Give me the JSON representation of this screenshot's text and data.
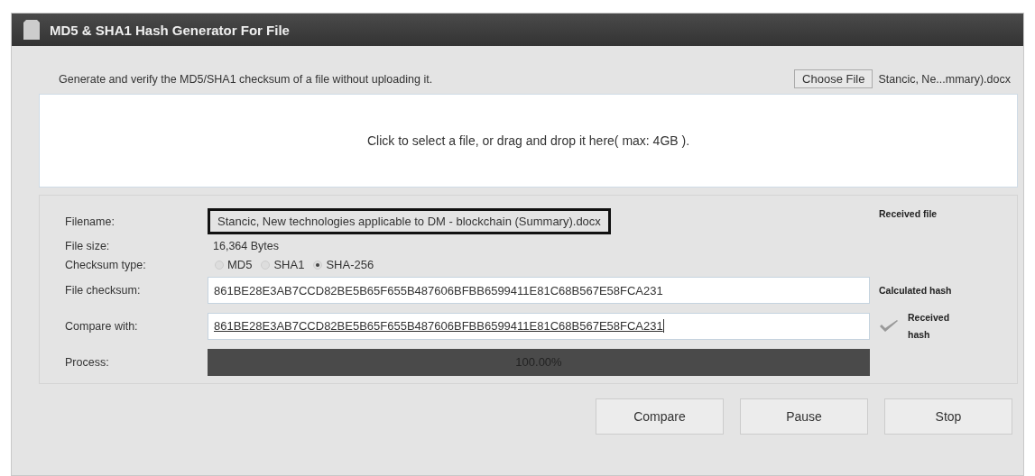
{
  "window": {
    "title": "MD5 & SHA1 Hash Generator For File"
  },
  "intro": "Generate and verify the MD5/SHA1 checksum of a file without uploading it.",
  "file_picker": {
    "button": "Choose File",
    "filename": "Stancic, Ne...mmary).docx"
  },
  "drop_zone": "Click to select a file, or drag and drop it here( max: 4GB ).",
  "form": {
    "filename": {
      "label": "Filename:",
      "value": "Stancic, New technologies applicable to DM - blockchain (Summary).docx",
      "note": "Received file"
    },
    "file_size": {
      "label": "File size:",
      "value": "16,364 Bytes"
    },
    "checksum_type": {
      "label": "Checksum type:",
      "options": [
        {
          "label": "MD5",
          "selected": false
        },
        {
          "label": "SHA1",
          "selected": false
        },
        {
          "label": "SHA-256",
          "selected": true
        }
      ]
    },
    "file_checksum": {
      "label": "File checksum:",
      "value": "861BE28E3AB7CCD82BE5B65F655B487606BFBB6599411E81C68B567E58FCA231",
      "note": "Calculated hash"
    },
    "compare_with": {
      "label": "Compare with:",
      "value": "861BE28E3AB7CCD82BE5B65F655B487606BFBB6599411E81C68B567E58FCA231",
      "match": true,
      "note": "Received hash"
    },
    "process": {
      "label": "Process:",
      "level": 1,
      "reading": "100.00%"
    }
  },
  "buttons": [
    "Compare",
    "Pause",
    "Stop"
  ]
}
